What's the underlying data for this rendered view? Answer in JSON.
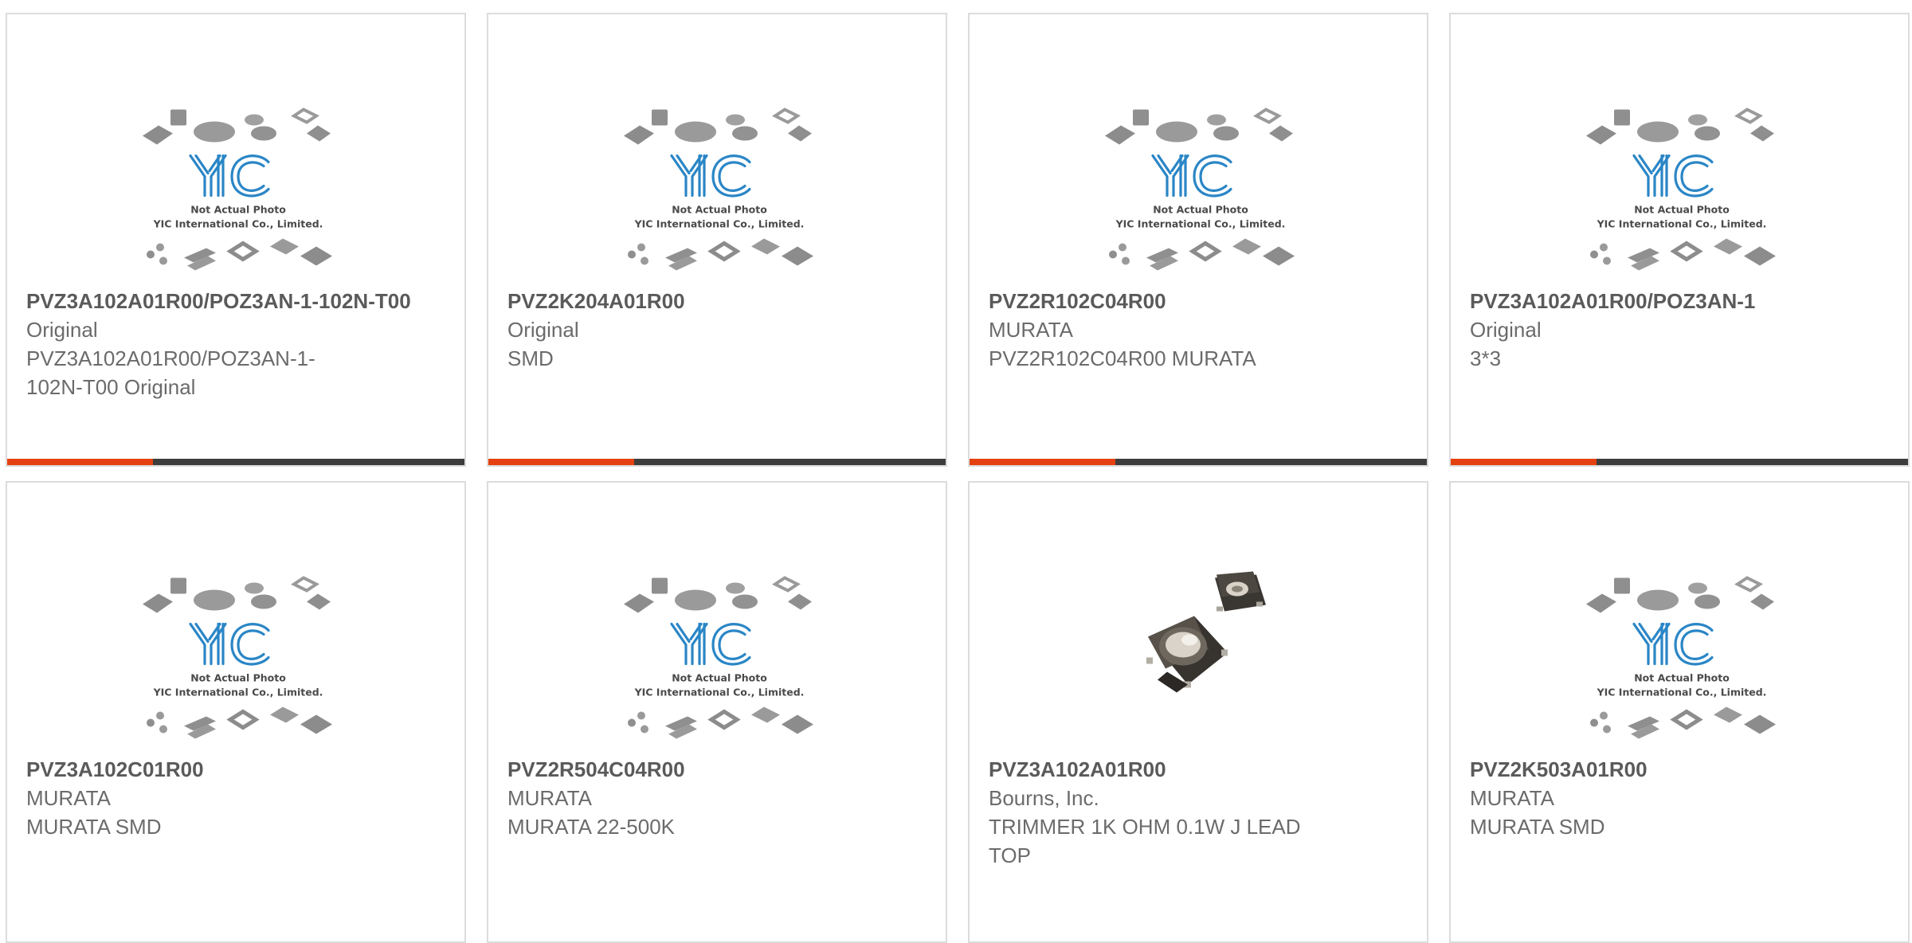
{
  "placeholder": {
    "line1": "Not Actual Photo",
    "line2": "YIC International Co., Limited.",
    "logo": "YIC"
  },
  "colors": {
    "accent": "#e5400f",
    "bar": "#3d3d3d",
    "logo_blue": "#2a86c6",
    "border": "#dcdcdc"
  },
  "products": [
    {
      "part": "PVZ3A102A01R00/POZ3AN-1-102N-T00",
      "brand": "Original",
      "desc": "PVZ3A102A01R00/POZ3AN-1-102N-T00 Original",
      "image": "yic-placeholder-image"
    },
    {
      "part": "PVZ2K204A01R00",
      "brand": "Original",
      "desc": "SMD",
      "image": "yic-placeholder-image"
    },
    {
      "part": "PVZ2R102C04R00",
      "brand": "MURATA",
      "desc": "PVZ2R102C04R00 MURATA",
      "image": "yic-placeholder-image"
    },
    {
      "part": "PVZ3A102A01R00/POZ3AN-1",
      "brand": "Original",
      "desc": "3*3",
      "image": "yic-placeholder-image"
    },
    {
      "part": "PVZ3A102C01R00",
      "brand": "MURATA",
      "desc": "MURATA SMD",
      "image": "yic-placeholder-image"
    },
    {
      "part": "PVZ2R504C04R00",
      "brand": "MURATA",
      "desc": "MURATA 22-500K",
      "image": "yic-placeholder-image"
    },
    {
      "part": "PVZ3A102A01R00",
      "brand": "Bourns, Inc.",
      "desc": "TRIMMER 1K OHM 0.1W J LEAD TOP",
      "image": "trimmer-potentiometer-photo"
    },
    {
      "part": "PVZ2K503A01R00",
      "brand": "MURATA",
      "desc": "MURATA SMD",
      "image": "yic-placeholder-image"
    }
  ]
}
